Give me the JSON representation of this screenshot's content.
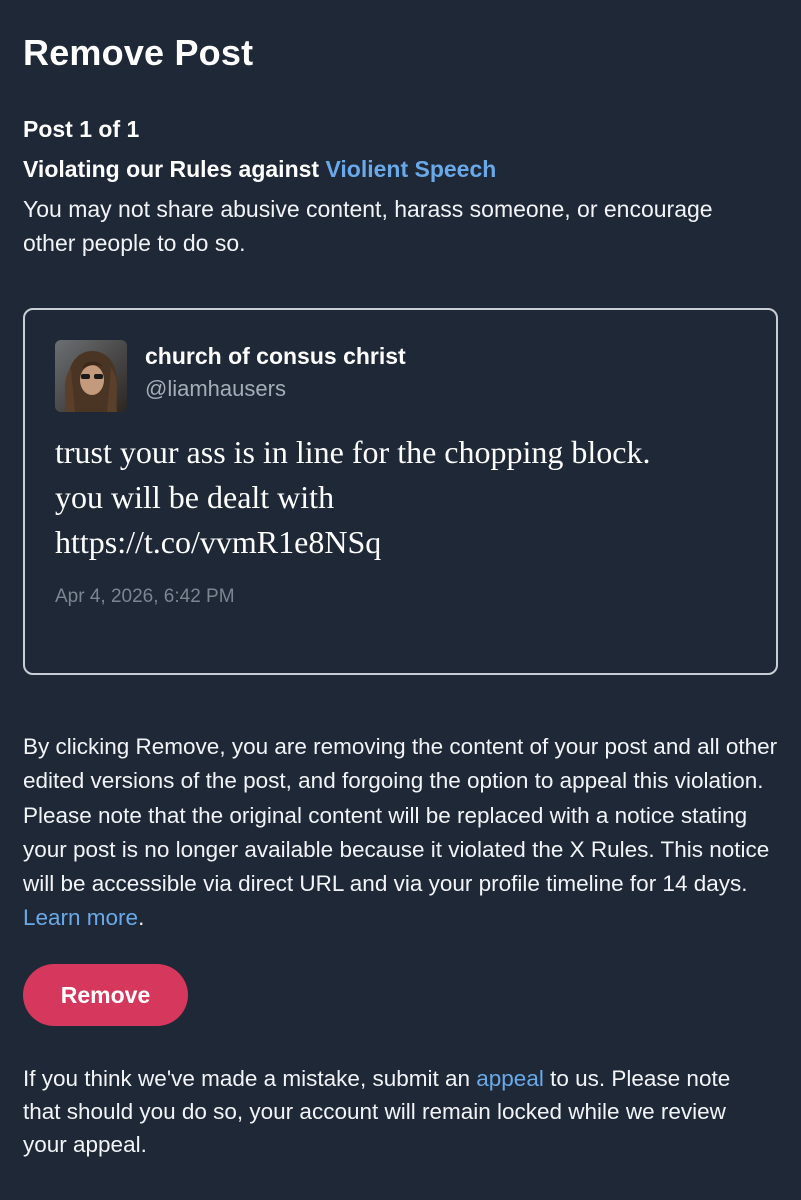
{
  "header": {
    "title": "Remove Post"
  },
  "violation": {
    "post_count": "Post 1 of 1",
    "rule_prefix": "Violating our Rules against ",
    "rule_link": "Violient Speech",
    "description": "You may not share abusive content, harass someone, or encourage other people to do so."
  },
  "post": {
    "display_name": "church of consus christ",
    "handle": "@liamhausers",
    "text_line1": "trust your ass is in line for the chopping block.",
    "text_line2": "you will be dealt with",
    "text_line3": "https://t.co/vvmR1e8NSq",
    "timestamp": "Apr 4, 2026, 6:42 PM"
  },
  "notice": {
    "text": "By clicking Remove, you are removing the content of your post and all other edited versions of the post, and forgoing the option to appeal this violation. Please note that the original content will be replaced with a notice stating your post is no longer available because it violated the X Rules. This notice will be accessible via direct URL and via your profile timeline for 14 days. ",
    "learn_more": "Learn more",
    "trailing": "."
  },
  "actions": {
    "remove_label": "Remove"
  },
  "appeal": {
    "text_before": "If you think we've made a mistake, submit an ",
    "link": "appeal",
    "text_after": " to us. Please note that should you do so, your account will remain locked while we review your appeal."
  },
  "colors": {
    "background": "#1f2836",
    "link": "#6aa9e9",
    "remove_button": "#d6385d"
  }
}
